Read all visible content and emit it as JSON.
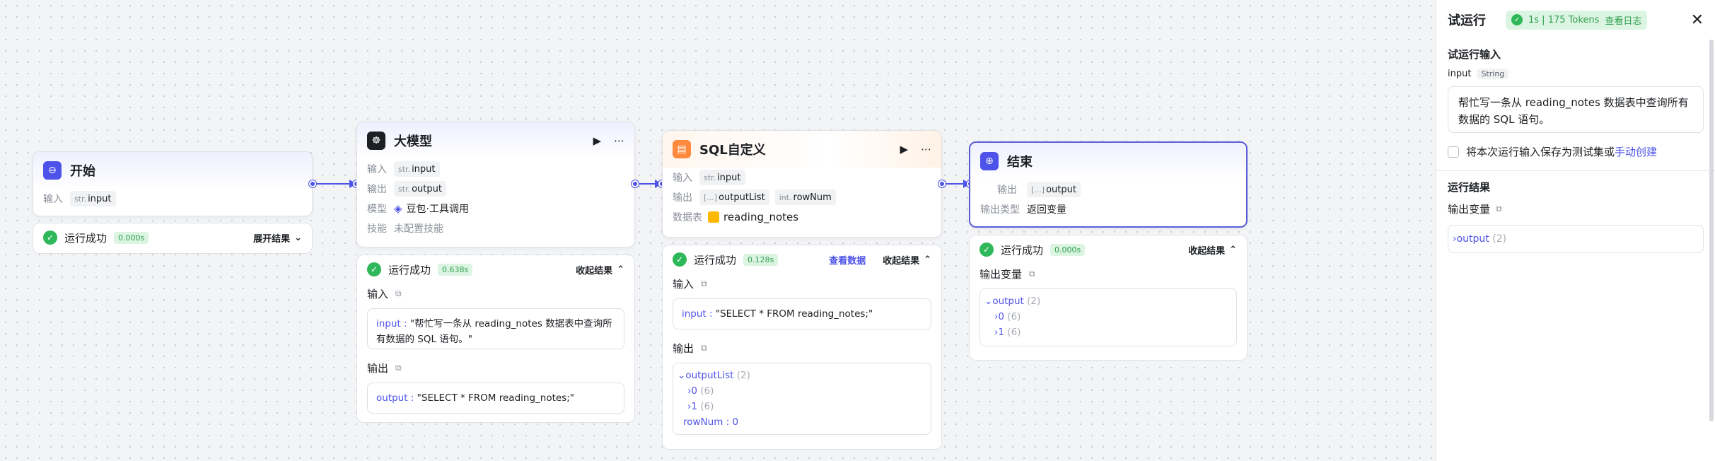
{
  "nodes": {
    "start": {
      "title": "开始",
      "input_label": "输入",
      "input_type": "str.",
      "input_name": "input",
      "result": {
        "status": "运行成功",
        "time": "0.000s",
        "toggle": "展开结果"
      }
    },
    "llm": {
      "title": "大模型",
      "input_label": "输入",
      "input_type": "str.",
      "input_name": "input",
      "output_label": "输出",
      "output_type": "str.",
      "output_name": "output",
      "model_label": "模型",
      "model_value": "豆包·工具调用",
      "skill_label": "技能",
      "skill_value": "未配置技能",
      "result": {
        "status": "运行成功",
        "time": "0.638s",
        "toggle": "收起结果",
        "input_title": "输入",
        "input_key": "input",
        "input_value": "\"帮忙写一条从 reading_notes 数据表中查询所有数据的 SQL 语句。\"",
        "output_title": "输出",
        "output_key": "output",
        "output_value": "\"SELECT * FROM reading_notes;\""
      }
    },
    "sql": {
      "title": "SQL自定义",
      "input_label": "输入",
      "input_type": "str.",
      "input_name": "input",
      "output_label": "输出",
      "output1_type": "[...]",
      "output1_name": "outputList",
      "output2_type": "int.",
      "output2_name": "rowNum",
      "table_label": "数据表",
      "table_value": "reading_notes",
      "result": {
        "status": "运行成功",
        "time": "0.128s",
        "view_data": "查看数据",
        "toggle": "收起结果",
        "input_title": "输入",
        "input_key": "input",
        "input_value": "\"SELECT * FROM reading_notes;\"",
        "output_title": "输出",
        "tree_root": "outputList",
        "tree_root_count": "(2)",
        "tree_items": [
          {
            "name": "0",
            "count": "(6)"
          },
          {
            "name": "1",
            "count": "(6)"
          }
        ],
        "rownum_key": "rowNum",
        "rownum_value": "0"
      }
    },
    "end": {
      "title": "结束",
      "output_label": "输出",
      "output_type": "[...]",
      "output_name": "output",
      "otype_label": "输出类型",
      "otype_value": "返回变量",
      "result": {
        "status": "运行成功",
        "time": "0.000s",
        "toggle": "收起结果",
        "var_title": "输出变量",
        "tree_root": "output",
        "tree_root_count": "(2)",
        "tree_items": [
          {
            "name": "0",
            "count": "(6)"
          },
          {
            "name": "1",
            "count": "(6)"
          }
        ]
      }
    }
  },
  "panel": {
    "title": "试运行",
    "token_text": "1s | 175 Tokens",
    "log_link": "查看日志",
    "input_section": "试运行输入",
    "input_name": "input",
    "input_type": "String",
    "input_value": "帮忙写一条从 reading_notes 数据表中查询所有数据的 SQL 语句。",
    "save_text": "将本次运行输入保存为测试集或",
    "manual_link": "手动创建",
    "result_section": "运行结果",
    "out_var_title": "输出变量",
    "out_name": "output",
    "out_count": "(2)"
  },
  "colors": {
    "accent": "#4d53e8",
    "success": "#2fb859",
    "sql_orange": "#ff8a3d"
  }
}
